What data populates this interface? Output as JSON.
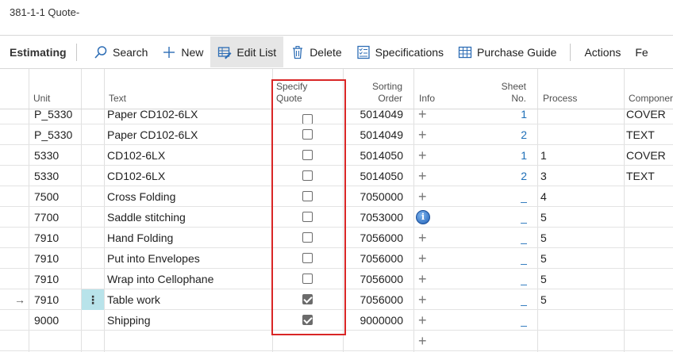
{
  "page": {
    "title": "381-1-1 Quote-"
  },
  "toolbar": {
    "title": "Estimating",
    "search_label": "Search",
    "new_label": "New",
    "edit_list_label": "Edit List",
    "delete_label": "Delete",
    "specifications_label": "Specifications",
    "purchase_guide_label": "Purchase Guide",
    "actions_label": "Actions",
    "more_label": "Fe"
  },
  "columns": {
    "unit": "Unit",
    "text": "Text",
    "specify_quote_1": "Specify",
    "specify_quote_2": "Quote",
    "sorting_order_1": "Sorting",
    "sorting_order_2": "Order",
    "info": "Info",
    "sheet_no_1": "Sheet",
    "sheet_no_2": "No.",
    "process": "Process",
    "component": "Componer"
  },
  "rows": [
    {
      "unit": "P_5330",
      "text": "Paper CD102-6LX",
      "checked": false,
      "sort": "5014049",
      "info": "+",
      "sheet": "1",
      "process": "",
      "component": "COVER"
    },
    {
      "unit": "P_5330",
      "text": "Paper CD102-6LX",
      "checked": false,
      "sort": "5014049",
      "info": "+",
      "sheet": "2",
      "process": "",
      "component": "TEXT"
    },
    {
      "unit": "5330",
      "text": "CD102-6LX",
      "checked": false,
      "sort": "5014050",
      "info": "+",
      "sheet": "1",
      "process": "1",
      "component": "COVER"
    },
    {
      "unit": "5330",
      "text": "CD102-6LX",
      "checked": false,
      "sort": "5014050",
      "info": "+",
      "sheet": "2",
      "process": "3",
      "component": "TEXT"
    },
    {
      "unit": "7500",
      "text": "Cross Folding",
      "checked": false,
      "sort": "7050000",
      "info": "+",
      "sheet": "_",
      "process": "4",
      "component": ""
    },
    {
      "unit": "7700",
      "text": "Saddle stitching",
      "checked": false,
      "sort": "7053000",
      "info": "i",
      "sheet": "_",
      "process": "5",
      "component": ""
    },
    {
      "unit": "7910",
      "text": "Hand Folding",
      "checked": false,
      "sort": "7056000",
      "info": "+",
      "sheet": "_",
      "process": "5",
      "component": ""
    },
    {
      "unit": "7910",
      "text": "Put into Envelopes",
      "checked": false,
      "sort": "7056000",
      "info": "+",
      "sheet": "_",
      "process": "5",
      "component": ""
    },
    {
      "unit": "7910",
      "text": "Wrap into Cellophane",
      "checked": false,
      "sort": "7056000",
      "info": "+",
      "sheet": "_",
      "process": "5",
      "component": ""
    },
    {
      "unit": "7910",
      "text": "Table work",
      "checked": true,
      "sort": "7056000",
      "info": "+",
      "sheet": "_",
      "process": "5",
      "component": "",
      "current": "→",
      "menu": "⋮"
    },
    {
      "unit": "9000",
      "text": "Shipping",
      "checked": true,
      "sort": "9000000",
      "info": "+",
      "sheet": "_",
      "process": "",
      "component": ""
    },
    {
      "unit": "",
      "text": "",
      "checked": false,
      "sort": "",
      "info": "+",
      "sheet": "",
      "process": "",
      "component": "",
      "empty": true
    }
  ]
}
